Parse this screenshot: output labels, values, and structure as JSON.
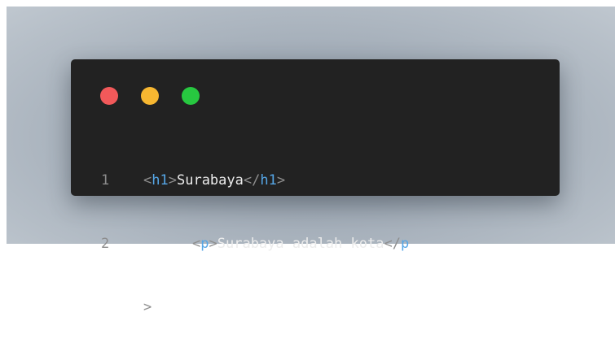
{
  "window_controls": [
    {
      "name": "close",
      "color": "#f2595a"
    },
    {
      "name": "minimize",
      "color": "#f7b731"
    },
    {
      "name": "maximize",
      "color": "#27c840"
    }
  ],
  "code_lines": [
    {
      "number": "1",
      "open_lt": "<",
      "open_tag": "h1",
      "open_gt": ">",
      "text": "Surabaya",
      "close_lt": "</",
      "close_tag": "h1",
      "close_gt": ">"
    },
    {
      "number": "2",
      "open_lt": "<",
      "open_tag": "p",
      "open_gt": ">",
      "text": "Surabaya adalah kota",
      "close_lt": "</",
      "close_tag": "p"
    }
  ],
  "wrap_continuation": ">"
}
